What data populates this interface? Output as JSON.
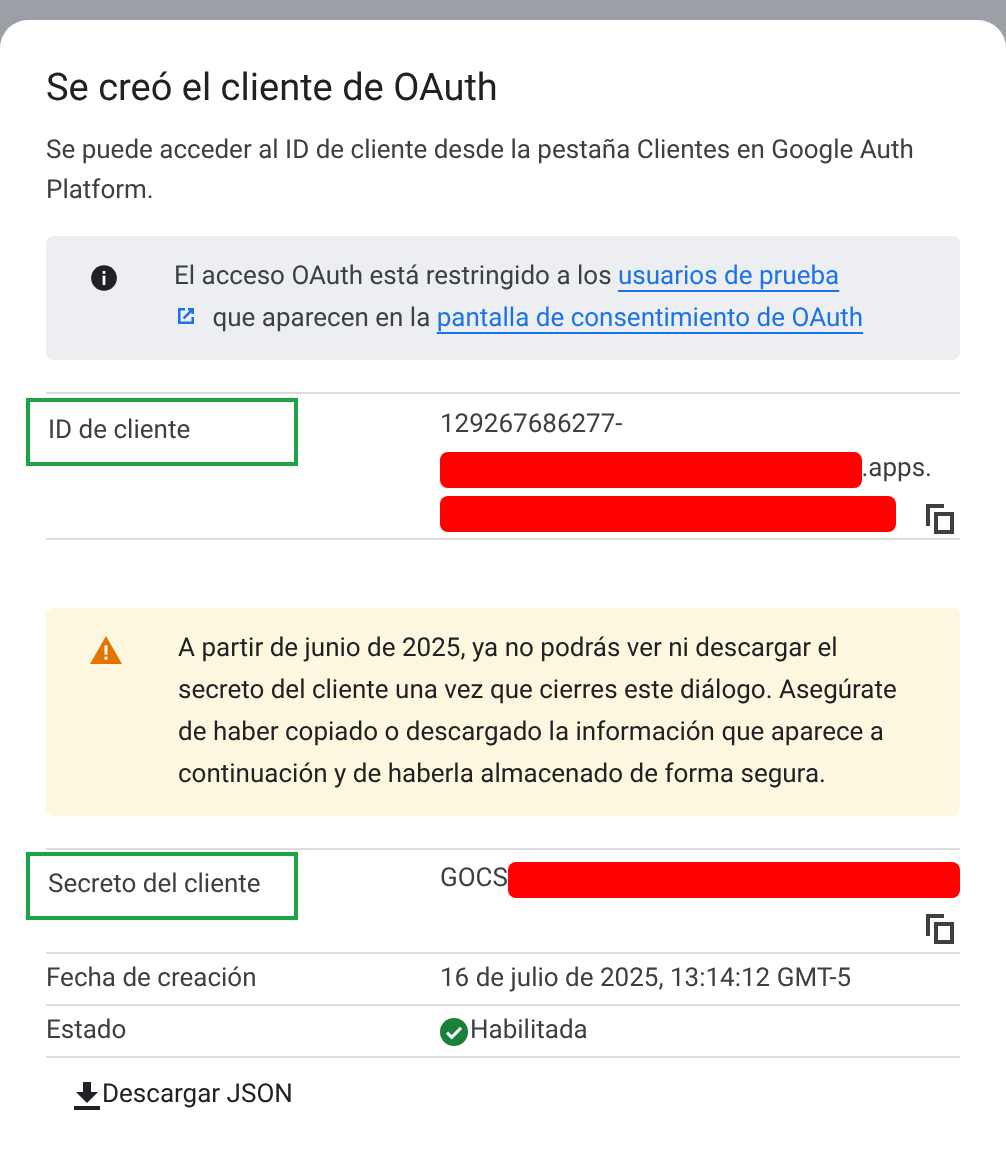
{
  "dialog": {
    "title": "Se creó el cliente de OAuth",
    "description": "Se puede acceder al ID de cliente desde la pestaña Clientes en Google Auth Platform."
  },
  "info_banner": {
    "parts": [
      {
        "kind": "text",
        "text": "El acceso OAuth está restringido a los "
      },
      {
        "kind": "link",
        "text": "usuarios de prueba"
      },
      {
        "kind": "external-icon"
      },
      {
        "kind": "text",
        "text": " que aparecen en la "
      },
      {
        "kind": "link",
        "text": "pantalla de consentimiento de OAuth"
      }
    ]
  },
  "client_id": {
    "label": "ID de cliente",
    "highlighted": true,
    "copyable": true,
    "lines": [
      [
        {
          "kind": "text",
          "text": "129267686277-"
        }
      ],
      [
        {
          "kind": "redacted"
        },
        {
          "kind": "text",
          "text": ".apps."
        }
      ],
      [
        {
          "kind": "redacted"
        }
      ]
    ]
  },
  "warning_banner": {
    "parts": [
      {
        "kind": "text",
        "text": "A partir de junio de 2025, ya no podrás ver ni descargar el secreto del cliente una vez que cierres este diálogo. Asegúrate de haber copiado o descargado la información que aparece a continuación y de haberla almacenado de forma segura."
      }
    ]
  },
  "client_secret": {
    "label": "Secreto del cliente",
    "highlighted": true,
    "copyable": true,
    "lines": [
      [
        {
          "kind": "text",
          "text": "GOCS"
        },
        {
          "kind": "redacted"
        }
      ]
    ]
  },
  "details": [
    {
      "kind": "text",
      "label": "Fecha de creación",
      "value": "16 de julio de 2025, 13:14:12 GMT-5"
    },
    {
      "kind": "status",
      "label": "Estado",
      "value": "Habilitada",
      "enabled": true
    }
  ],
  "download_button": {
    "label": "Descargar JSON"
  }
}
